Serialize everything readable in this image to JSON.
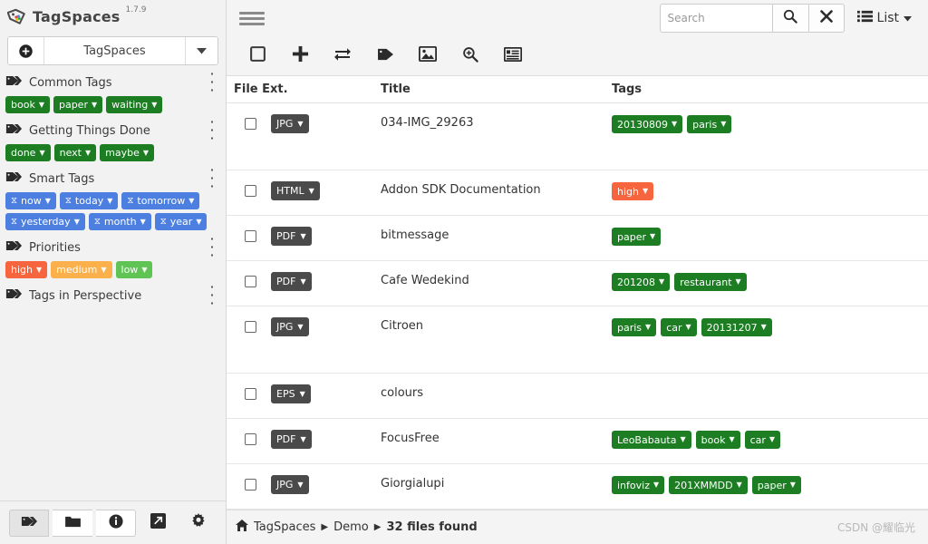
{
  "sidebar": {
    "brand": {
      "name": "TagSpaces",
      "version": "1.7.9",
      "logo_icon": "tagspaces-logo-icon"
    },
    "location": {
      "add_icon": "add-location-icon",
      "name": "TagSpaces",
      "caret_icon": "chevron-down-icon"
    },
    "groups": [
      {
        "title": "Common Tags",
        "icon": "tags-icon",
        "menu_icon": "vertical-dots-icon",
        "tags": [
          {
            "label": "book",
            "color": "green"
          },
          {
            "label": "paper",
            "color": "green"
          },
          {
            "label": "waiting",
            "color": "green"
          }
        ]
      },
      {
        "title": "Getting Things Done",
        "icon": "tags-icon",
        "menu_icon": "vertical-dots-icon",
        "tags": [
          {
            "label": "done",
            "color": "green"
          },
          {
            "label": "next",
            "color": "green"
          },
          {
            "label": "maybe",
            "color": "green"
          }
        ]
      },
      {
        "title": "Smart Tags",
        "icon": "tags-icon",
        "menu_icon": "vertical-dots-icon",
        "tags": [
          {
            "label": "now",
            "color": "blue",
            "prefix_icon": "flask-icon"
          },
          {
            "label": "today",
            "color": "blue",
            "prefix_icon": "flask-icon"
          },
          {
            "label": "tomorrow",
            "color": "blue",
            "prefix_icon": "flask-icon"
          },
          {
            "label": "yesterday",
            "color": "blue",
            "prefix_icon": "flask-icon"
          },
          {
            "label": "month",
            "color": "blue",
            "prefix_icon": "flask-icon"
          },
          {
            "label": "year",
            "color": "blue",
            "prefix_icon": "flask-icon"
          }
        ]
      },
      {
        "title": "Priorities",
        "icon": "tags-icon",
        "menu_icon": "vertical-dots-icon",
        "tags": [
          {
            "label": "high",
            "color": "high"
          },
          {
            "label": "medium",
            "color": "med"
          },
          {
            "label": "low",
            "color": "low"
          }
        ]
      },
      {
        "title": "Tags in Perspective",
        "icon": "tags-icon",
        "menu_icon": "vertical-dots-icon",
        "tags": []
      }
    ],
    "footer_buttons": [
      {
        "name": "tag-library-button",
        "icon": "tags-icon",
        "active": true
      },
      {
        "name": "file-manager-button",
        "icon": "folder-icon",
        "active": false
      },
      {
        "name": "info-button",
        "icon": "info-circle-icon",
        "active": false
      },
      {
        "name": "open-external-button",
        "icon": "external-link-icon",
        "active": false
      },
      {
        "name": "settings-button",
        "icon": "gear-icon",
        "active": false
      }
    ]
  },
  "main": {
    "menu_icon": "hamburger-menu-icon",
    "search": {
      "placeholder": "Search",
      "value": "",
      "search_icon": "magnifier-icon",
      "clear_icon": "close-x-icon"
    },
    "view_switch": {
      "label": "List",
      "icon": "list-icon",
      "caret": "chevron-down-icon"
    },
    "toolbar": [
      {
        "name": "select-all-button",
        "icon": "empty-checkbox-icon"
      },
      {
        "name": "create-file-button",
        "icon": "plus-icon"
      },
      {
        "name": "move-copy-button",
        "icon": "exchange-icon"
      },
      {
        "name": "add-tags-button",
        "icon": "tag-icon"
      },
      {
        "name": "show-thumbnails-button",
        "icon": "image-icon"
      },
      {
        "name": "zoom-button",
        "icon": "magnifier-plus-icon"
      },
      {
        "name": "toggle-details-button",
        "icon": "list-detail-icon"
      }
    ],
    "columns": [
      "File Ext.",
      "Title",
      "Tags"
    ],
    "rows": [
      {
        "selected": false,
        "ext": "JPG",
        "title": "034-IMG_29263",
        "tall": true,
        "tags": [
          {
            "label": "20130809",
            "color": "green"
          },
          {
            "label": "paris",
            "color": "green"
          }
        ]
      },
      {
        "selected": false,
        "ext": "HTML",
        "title": "Addon SDK Documentation",
        "tall": false,
        "tags": [
          {
            "label": "high",
            "color": "high"
          }
        ]
      },
      {
        "selected": false,
        "ext": "PDF",
        "title": "bitmessage",
        "tall": false,
        "tags": [
          {
            "label": "paper",
            "color": "green"
          }
        ]
      },
      {
        "selected": false,
        "ext": "PDF",
        "title": "Cafe Wedekind",
        "tall": false,
        "tags": [
          {
            "label": "201208",
            "color": "green"
          },
          {
            "label": "restaurant",
            "color": "green"
          }
        ]
      },
      {
        "selected": false,
        "ext": "JPG",
        "title": "Citroen",
        "tall": true,
        "tags": [
          {
            "label": "paris",
            "color": "green"
          },
          {
            "label": "car",
            "color": "green"
          },
          {
            "label": "20131207",
            "color": "green"
          }
        ]
      },
      {
        "selected": false,
        "ext": "EPS",
        "title": "colours",
        "tall": false,
        "tags": []
      },
      {
        "selected": false,
        "ext": "PDF",
        "title": "FocusFree",
        "tall": false,
        "tags": [
          {
            "label": "LeoBabauta",
            "color": "green"
          },
          {
            "label": "book",
            "color": "green"
          },
          {
            "label": "car",
            "color": "green"
          }
        ]
      },
      {
        "selected": false,
        "ext": "JPG",
        "title": "Giorgialupi",
        "tall": false,
        "tags": [
          {
            "label": "infoviz",
            "color": "green"
          },
          {
            "label": "201XMMDD",
            "color": "green"
          },
          {
            "label": "paper",
            "color": "green"
          }
        ]
      }
    ],
    "status": {
      "home_icon": "home-icon",
      "crumbs": [
        "TagSpaces",
        "Demo"
      ],
      "count_text": "32 files found"
    },
    "watermark": "CSDN @耀临光"
  },
  "colors": {
    "tag_green": "#1d7d23",
    "tag_blue": "#4d7fe0",
    "priority_high": "#f7653e",
    "priority_medium": "#fbb04c",
    "priority_low": "#5fc453",
    "ext_badge": "#4a4a4a",
    "chrome": "#f4f4f4"
  }
}
